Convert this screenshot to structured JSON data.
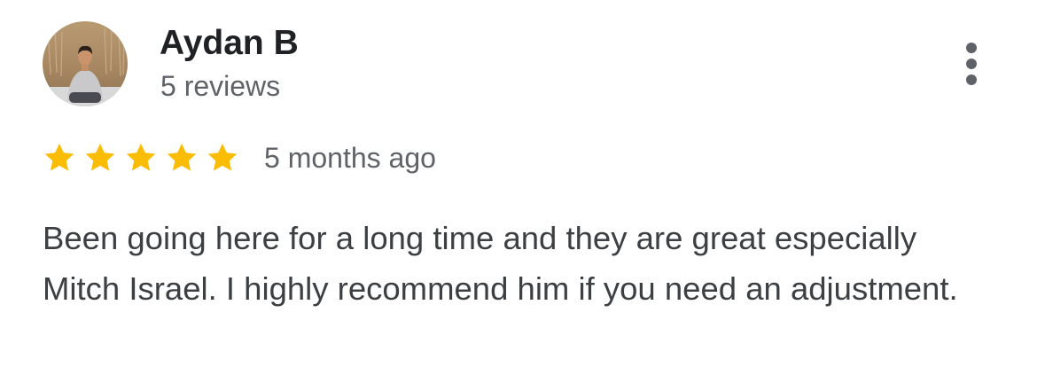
{
  "review": {
    "reviewer": {
      "name": "Aydan B",
      "meta": "5 reviews",
      "avatar_icon": "user-photo-avatar"
    },
    "rating": {
      "value": 5,
      "max": 5,
      "star_color": "#fbbc04"
    },
    "time_ago": "5 months ago",
    "text": "Been going here for a long time and they are great especially Mitch Israel. I highly recommend him if you need an adjustment.",
    "menu_icon": "more-vert-icon"
  },
  "colors": {
    "name": "#202124",
    "secondary": "#5f6368",
    "body": "#3c4043",
    "star": "#fbbc04",
    "menu": "#5f6368"
  }
}
